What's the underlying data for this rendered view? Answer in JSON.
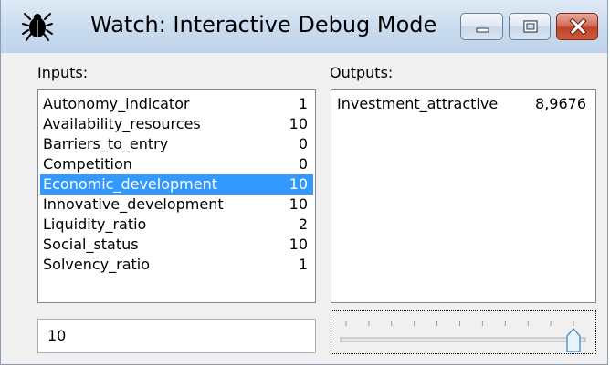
{
  "window": {
    "title": "Watch: Interactive Debug Mode",
    "icons": {
      "app": "bug-icon",
      "minimize": "minimize-icon",
      "maximize": "maximize-icon",
      "close": "close-icon"
    },
    "colors": {
      "selection": "#3399ff",
      "close_button": "#c7472e"
    }
  },
  "inputs": {
    "label_accel": "I",
    "label_rest": "nputs:",
    "items": [
      {
        "name": "Autonomy_indicator",
        "value": "1"
      },
      {
        "name": "Availability_resources",
        "value": "10"
      },
      {
        "name": "Barriers_to_entry",
        "value": "0"
      },
      {
        "name": "Competition",
        "value": "0"
      },
      {
        "name": "Economic_development",
        "value": "10"
      },
      {
        "name": "Innovative_development",
        "value": "10"
      },
      {
        "name": "Liquidity_ratio",
        "value": "2"
      },
      {
        "name": "Social_status",
        "value": "10"
      },
      {
        "name": "Solvency_ratio",
        "value": "1"
      }
    ],
    "selected_index": 4
  },
  "outputs": {
    "label_accel": "O",
    "label_rest": "utputs:",
    "items": [
      {
        "name": "Investment_attractive",
        "value": "8,9676"
      }
    ]
  },
  "value_field": {
    "value": "10"
  },
  "slider": {
    "level": 1.0,
    "tick_count": 11
  }
}
